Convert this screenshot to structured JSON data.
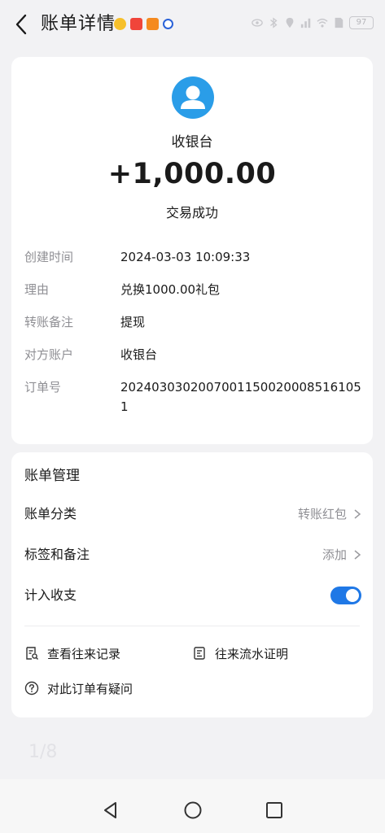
{
  "header": {
    "title": "账单详情",
    "battery": "97"
  },
  "colors": {
    "accent": "#1f78e6",
    "avatar": "#2a9de8",
    "background": "#f2f2f4"
  },
  "transaction": {
    "merchant": "收银台",
    "amount": "+1,000.00",
    "status": "交易成功"
  },
  "details": [
    {
      "label": "创建时间",
      "value": "2024-03-03 10:09:33"
    },
    {
      "label": "理由",
      "value": "兑换1000.00礼包"
    },
    {
      "label": "转账备注",
      "value": "提现"
    },
    {
      "label": "对方账户",
      "value": "收银台"
    },
    {
      "label": "订单号",
      "value": "2024030302007001150020008516105 1"
    }
  ],
  "management": {
    "title": "账单管理",
    "category_label": "账单分类",
    "category_value": "转账红包",
    "tags_label": "标签和备注",
    "tags_value": "添加",
    "income_label": "计入收支",
    "income_enabled": true,
    "links": {
      "history": "查看往来记录",
      "proof": "往来流水证明",
      "question": "对此订单有疑问"
    }
  },
  "page_indicator": "1/8"
}
